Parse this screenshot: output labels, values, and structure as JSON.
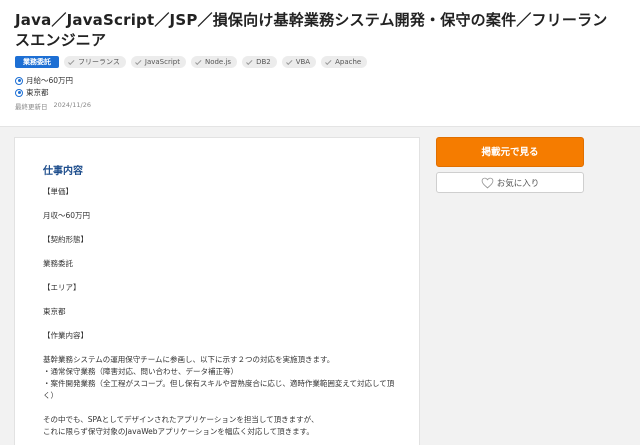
{
  "job": {
    "title": "Java／JavaScript／JSP／損保向け基幹業務システム開発・保守の案件／フリーランスエンジニア",
    "contract_type_badge": "業務委託",
    "tags": [
      "フリーランス",
      "JavaScript",
      "Node.js",
      "DB2",
      "VBA",
      "Apache"
    ],
    "salary": "月給～60万円",
    "location": "東京都",
    "updated_label": "最終更新日",
    "updated_date": "2024/11/26"
  },
  "detail": {
    "section_title": "仕事内容",
    "paragraphs": [
      "【単価】",
      "月収～60万円",
      "【契約形態】",
      "業務委託",
      "【エリア】",
      "東京都",
      "【作業内容】",
      "基幹業務システムの運用保守チームに参画し、以下に示す２つの対応を実施頂きます。\n・通常保守業務（障害対応、問い合わせ、データ補正等）\n・案件開発業務（全工程がスコープ。但し保有スキルや習熟度合に応じ、適時作業範囲変えて対応して頂く）",
      "その中でも、SPAとしてデザインされたアプリケーションを担当して頂きますが、\nこれに限らず保守対象のJavaWebアプリケーションを幅広く対応して頂きます。"
    ]
  },
  "actions": {
    "apply_label": "掲載元で見る",
    "favorite_label": "お気に入り"
  },
  "colors": {
    "primary_orange": "#f57c00",
    "badge_blue": "#1d6fd4",
    "section_title_blue": "#1d4d8c"
  },
  "icons": {
    "salary": "pin-icon",
    "location": "pin-icon",
    "tag": "check-icon",
    "favorite": "heart-icon"
  }
}
